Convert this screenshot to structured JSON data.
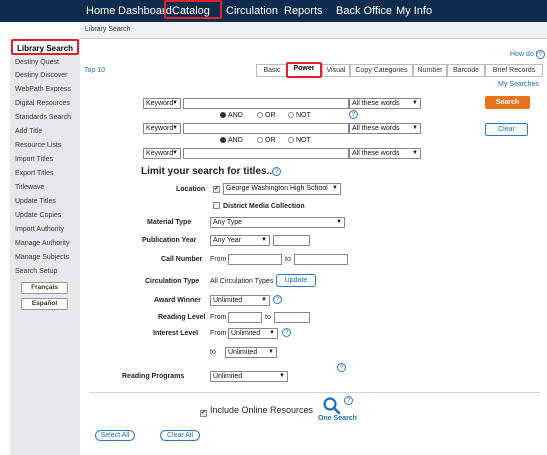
{
  "topnav": {
    "items": [
      "Home",
      "Dashboard",
      "Catalog",
      "Circulation",
      "Reports",
      "Back Office",
      "My Info"
    ]
  },
  "breadcrumb": "Library Search",
  "sidebar": {
    "items": [
      "Library Search",
      "Destiny Quest",
      "Destiny Discover",
      "WebPath Express",
      "Digital Resources",
      "Standards Search",
      "Add Title",
      "Resource Lists",
      "Import Titles",
      "Export Titles",
      "Titlewave",
      "Update Titles",
      "Update Copies",
      "Import Authority",
      "Manage Authority",
      "Manage Subjects",
      "Search Setup"
    ],
    "lang_buttons": [
      "Français",
      "Español"
    ]
  },
  "header": {
    "top10": "Top 10",
    "how_do_i": "How do I..",
    "my_searches": "My Searches"
  },
  "tabs": [
    "Basic",
    "Power",
    "Visual",
    "Copy Categories",
    "Number",
    "Barcode",
    "Brief Records"
  ],
  "query": {
    "rows": [
      {
        "field": "Keyword",
        "match": "All these words"
      },
      {
        "field": "Keyword",
        "match": "All these words"
      },
      {
        "field": "Keyword",
        "match": "All these words"
      }
    ],
    "ops": [
      "AND",
      "OR",
      "NOT"
    ],
    "search_button": "Search",
    "clear_button": "Clear"
  },
  "limits": {
    "heading": "Limit your search for titles...",
    "location_label": "Location",
    "location_value": "George Washington High School",
    "district_label": "District Media Collection",
    "material_label": "Material Type",
    "material_value": "Any Type",
    "pubyear_label": "Publication Year",
    "pubyear_value": "Any Year",
    "callnumber_label": "Call Number",
    "from": "From",
    "to": "to",
    "circ_label": "Circulation Type",
    "circ_value": "All Circulation Types",
    "update_button": "Update",
    "award_label": "Award Winner",
    "award_value": "Unlimited",
    "reading_level_label": "Reading Level",
    "interest_label": "Interest Level",
    "interest_from_value": "Unlimited",
    "interest_to_value": "Unlimited",
    "reading_programs_label": "Reading Programs",
    "reading_programs_value": "Unlimited"
  },
  "footer": {
    "include_online": "Include Online Resources",
    "one_search": "One Search",
    "select_all": "Select All",
    "clear_all": "Clear All"
  }
}
